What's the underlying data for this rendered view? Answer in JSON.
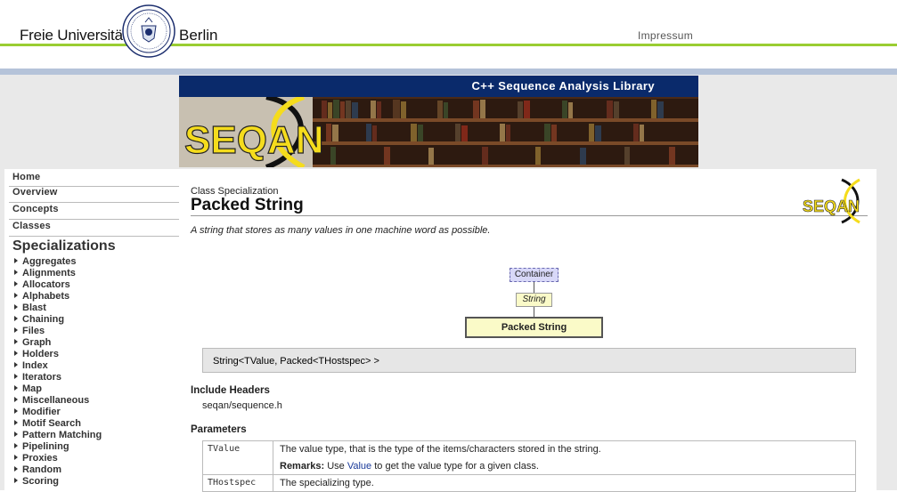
{
  "header": {
    "org_left": "Freie Universität",
    "org_right": "Berlin",
    "impressum": "Impressum",
    "colors": {
      "accent_green": "#9acd32",
      "accent_blue": "#b5c3d9"
    }
  },
  "banner": {
    "tagline": "C++ Sequence Analysis Library",
    "logo_text": "SEQAN",
    "colors": {
      "bar": "#0a2a6b",
      "logo_yellow": "#f5dc1c"
    }
  },
  "sidebar": {
    "top_items": [
      {
        "label": "Home"
      },
      {
        "label": "Overview"
      },
      {
        "label": "Concepts"
      },
      {
        "label": "Classes"
      }
    ],
    "section_title": "Specializations",
    "spec_items": [
      "Aggregates",
      "Alignments",
      "Allocators",
      "Alphabets",
      "Blast",
      "Chaining",
      "Files",
      "Graph",
      "Holders",
      "Index",
      "Iterators",
      "Map",
      "Miscellaneous",
      "Modifier",
      "Motif Search",
      "Pattern Matching",
      "Pipelining",
      "Proxies",
      "Random",
      "Scoring"
    ]
  },
  "content": {
    "kicker": "Class Specialization",
    "title": "Packed String",
    "summary": "A string that stores as many values in one machine word as possible.",
    "diagram": {
      "concept": "Container",
      "base": "String",
      "current": "Packed String"
    },
    "signature": "String<TValue, Packed<THostspec> >",
    "include_heading": "Include Headers",
    "include_file": "seqan/sequence.h",
    "params_heading": "Parameters",
    "params": [
      {
        "name": "TValue",
        "desc": "The value type, that is the type of the items/characters stored in the string.",
        "remarks_label": "Remarks:",
        "remarks_pre": "Use",
        "remarks_link": "Value",
        "remarks_post": "to get the value type for a given class."
      },
      {
        "name": "THostspec",
        "desc": "The specializing type."
      }
    ]
  }
}
